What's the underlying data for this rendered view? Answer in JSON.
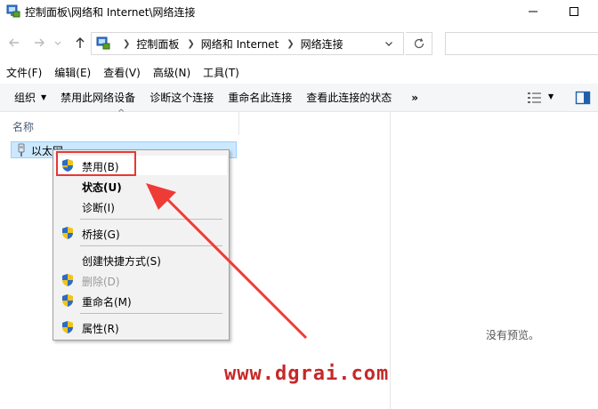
{
  "window": {
    "title": "控制面板\\网络和 Internet\\网络连接"
  },
  "address": {
    "crumbs": [
      "控制面板",
      "网络和 Internet",
      "网络连接"
    ]
  },
  "menu": [
    "文件(F)",
    "编辑(E)",
    "查看(V)",
    "高级(N)",
    "工具(T)"
  ],
  "toolbar": {
    "organize": "组织",
    "disable": "禁用此网络设备",
    "diagnose": "诊断这个连接",
    "rename": "重命名此连接",
    "status": "查看此连接的状态",
    "more": "»"
  },
  "list": {
    "column_name": "名称",
    "items": [
      {
        "label": "以太网"
      }
    ]
  },
  "preview": {
    "empty_text": "没有预览。"
  },
  "context_menu": {
    "items": [
      {
        "label": "禁用(B)",
        "icon": "shield-icon",
        "style": "highlight"
      },
      {
        "label": "状态(U)",
        "icon": "",
        "style": "bold"
      },
      {
        "label": "诊断(I)",
        "icon": "",
        "style": "normal"
      },
      {
        "label": "桥接(G)",
        "icon": "shield-icon",
        "style": "normal"
      },
      {
        "label": "创建快捷方式(S)",
        "icon": "",
        "style": "normal"
      },
      {
        "label": "删除(D)",
        "icon": "shield-icon",
        "style": "disabled"
      },
      {
        "label": "重命名(M)",
        "icon": "shield-icon",
        "style": "normal"
      },
      {
        "label": "属性(R)",
        "icon": "shield-icon",
        "style": "normal"
      }
    ]
  },
  "annotation": {
    "highlight_color": "#e53935"
  },
  "watermark": "www.dgrai.com"
}
